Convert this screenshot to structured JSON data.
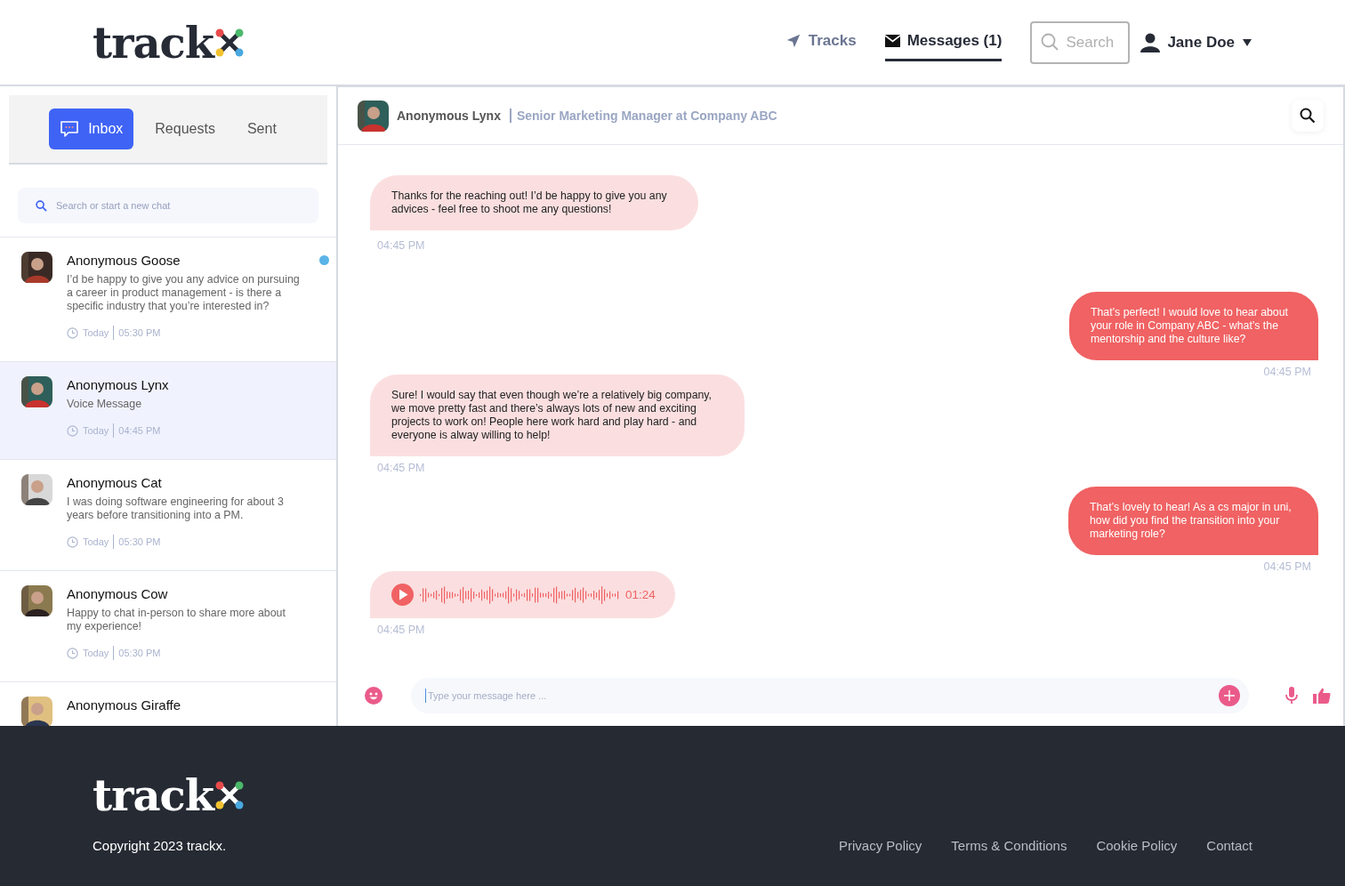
{
  "header": {
    "logo": "track",
    "nav": [
      {
        "kind": "tracks",
        "label": "Tracks",
        "selected": false
      },
      {
        "kind": "messages",
        "label": "Messages (1)",
        "selected": true
      }
    ],
    "search": {
      "placeholder": "Search"
    },
    "user": {
      "name": "Jane Doe"
    }
  },
  "sidebar": {
    "tabs": [
      {
        "label": "Inbox",
        "selected": true
      },
      {
        "label": "Requests",
        "selected": false
      },
      {
        "label": "Sent",
        "selected": false
      }
    ],
    "search": {
      "placeholder": "Search or start a new chat"
    },
    "chats": [
      {
        "name": "Anonymous Goose",
        "preview": "I’d be happy to give you any advice on pursuing a career in product management - is there a specific industry that you’re interested in?",
        "day": "Today",
        "time": "05:30 PM",
        "unread": true,
        "selected": false
      },
      {
        "name": "Anonymous Lynx",
        "preview": "Voice Message",
        "day": "Today",
        "time": "04:45 PM",
        "unread": false,
        "selected": true
      },
      {
        "name": "Anonymous Cat",
        "preview": "I was doing software engineering for about 3 years before transitioning into a PM.",
        "day": "Today",
        "time": "05:30 PM",
        "unread": false,
        "selected": false
      },
      {
        "name": "Anonymous Cow",
        "preview": "Happy to chat in-person to share more about my experience!",
        "day": "Today",
        "time": "05:30 PM",
        "unread": false,
        "selected": false
      },
      {
        "name": "Anonymous Giraffe",
        "unread": false,
        "selected": false
      }
    ]
  },
  "chat": {
    "contact": {
      "name": "Anonymous Lynx",
      "role": "Senior Marketing Manager at Company ABC"
    },
    "messages": [
      {
        "kind": "received",
        "text": "Thanks for the reaching out! I’d be happy to give you any advices - feel free to shoot me any questions!",
        "time": "04:45 PM"
      },
      {
        "kind": "sent",
        "text": "That’s perfect! I would love to hear about your role in Company ABC - what’s the mentorship and the culture like?",
        "time": "04:45 PM"
      },
      {
        "kind": "received",
        "text": "Sure! I would say that even though we’re a relatively big company, we move pretty fast and there’s always lots of new and exciting projects to work on! People here work hard and play hard - and everyone is alway willing to help!",
        "time": "04:45 PM"
      },
      {
        "kind": "sent",
        "text": "That’s lovely to hear! As a cs major in uni, how did you find the transition into your marketing role?",
        "time": "04:45 PM"
      },
      {
        "kind": "voice",
        "duration": "01:24",
        "time": "04:45 PM"
      }
    ],
    "composer": {
      "placeholder": "Type your message here ..."
    }
  },
  "footer": {
    "logo": "track",
    "copyright": "Copyright 2023 trackx.",
    "links": [
      "Privacy Policy",
      "Terms & Conditions",
      "Cookie Policy",
      "Contact"
    ]
  }
}
